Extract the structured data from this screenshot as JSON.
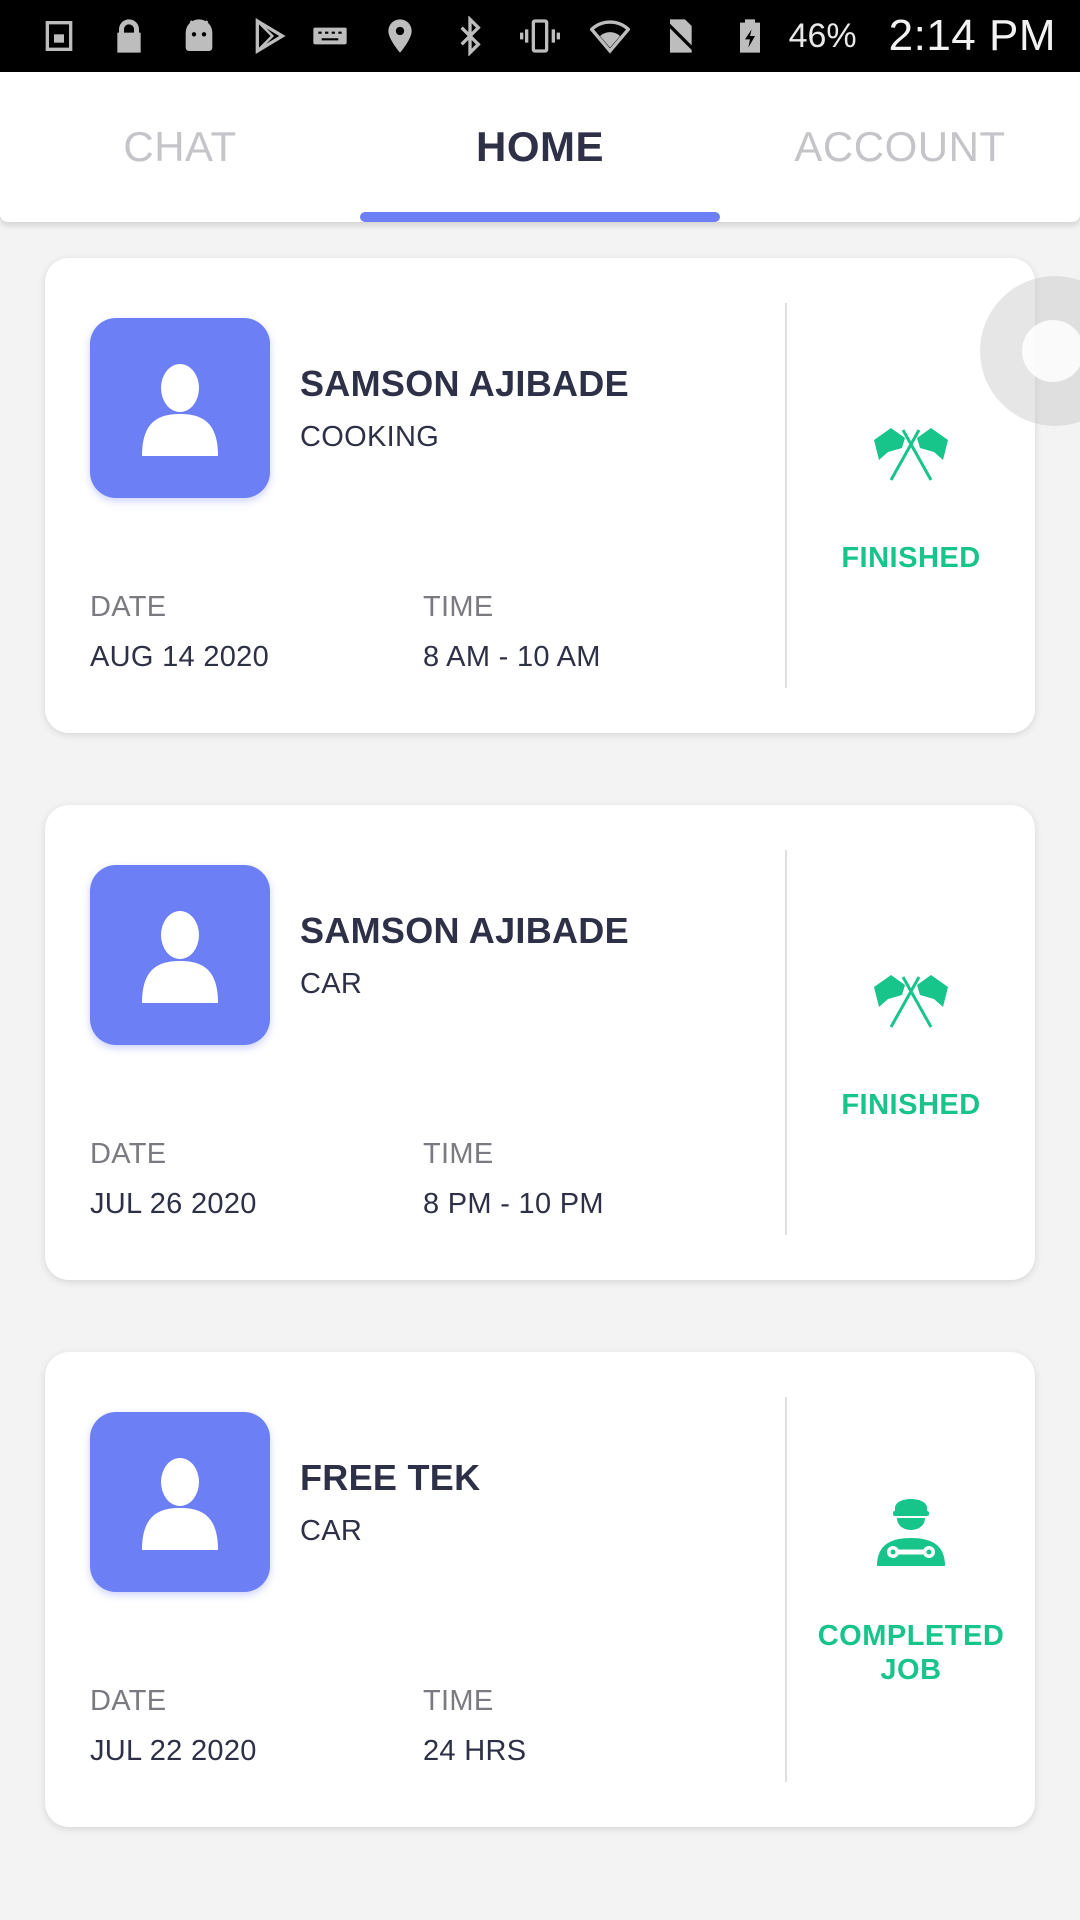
{
  "status_bar": {
    "battery": "46%",
    "time": "2:14 PM",
    "left_icons": [
      "screenshot-icon",
      "lock-icon",
      "android-icon",
      "play-store-icon"
    ],
    "right_icons": [
      "keyboard-icon",
      "location-icon",
      "bluetooth-icon",
      "vibrate-icon",
      "wifi-icon",
      "no-sim-icon",
      "battery-icon"
    ]
  },
  "tabs": [
    {
      "label": "CHAT",
      "active": false
    },
    {
      "label": "HOME",
      "active": true
    },
    {
      "label": "ACCOUNT",
      "active": false
    }
  ],
  "colors": {
    "accent": "#6c7ff5",
    "success": "#17c48a",
    "text_dark": "#2e3047",
    "text_muted": "#7a7a80"
  },
  "jobs": [
    {
      "name": "SAMSON AJIBADE",
      "service": "COOKING",
      "date_label": "DATE",
      "date": "AUG 14 2020",
      "time_label": "TIME",
      "time": "8 AM - 10 AM",
      "status": "FINISHED",
      "status_icon": "finish-flags-icon"
    },
    {
      "name": "SAMSON AJIBADE",
      "service": "CAR",
      "date_label": "DATE",
      "date": "JUL 26 2020",
      "time_label": "TIME",
      "time": "8 PM - 10 PM",
      "status": "FINISHED",
      "status_icon": "finish-flags-icon"
    },
    {
      "name": "FREE TEK",
      "service": "CAR",
      "date_label": "DATE",
      "date": "JUL 22 2020",
      "time_label": "TIME",
      "time": "24 HRS",
      "status_line1": "COMPLETED",
      "status_line2": "JOB",
      "status_icon": "mechanic-icon"
    }
  ]
}
